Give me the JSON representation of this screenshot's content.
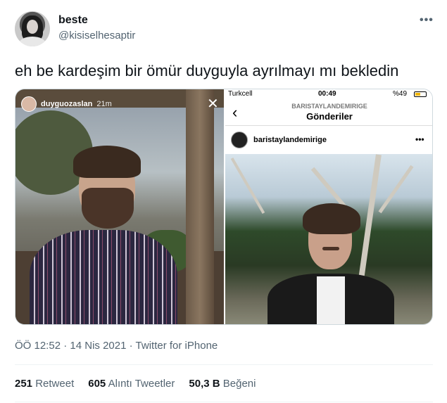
{
  "author": {
    "display_name": "beste",
    "handle": "@kisiselhesaptir"
  },
  "more_icon": "more-horizontal-icon",
  "tweet_text": "eh be kardeşim bir ömür duyguyla ayrılmayı mı bekledin",
  "media_left": {
    "story_username": "duyguozaslan",
    "story_time": "21m",
    "close_icon": "close-icon"
  },
  "media_right": {
    "carrier": "Turkcell",
    "time": "00:49",
    "battery": "%49",
    "battery_level": 0.49,
    "nav_subtitle": "BARISTAYLANDEMIRIGE",
    "nav_title": "Gönderiler",
    "post_username": "baristaylandemirige"
  },
  "meta": {
    "time": "ÖÖ 12:52",
    "separator": "·",
    "date": "14 Nis 2021",
    "source": "Twitter for iPhone"
  },
  "stats": {
    "retweets_count": "251",
    "retweets_label": "Retweet",
    "quotes_count": "605",
    "quotes_label": "Alıntı Tweetler",
    "likes_count": "50,3 B",
    "likes_label": "Beğeni"
  }
}
